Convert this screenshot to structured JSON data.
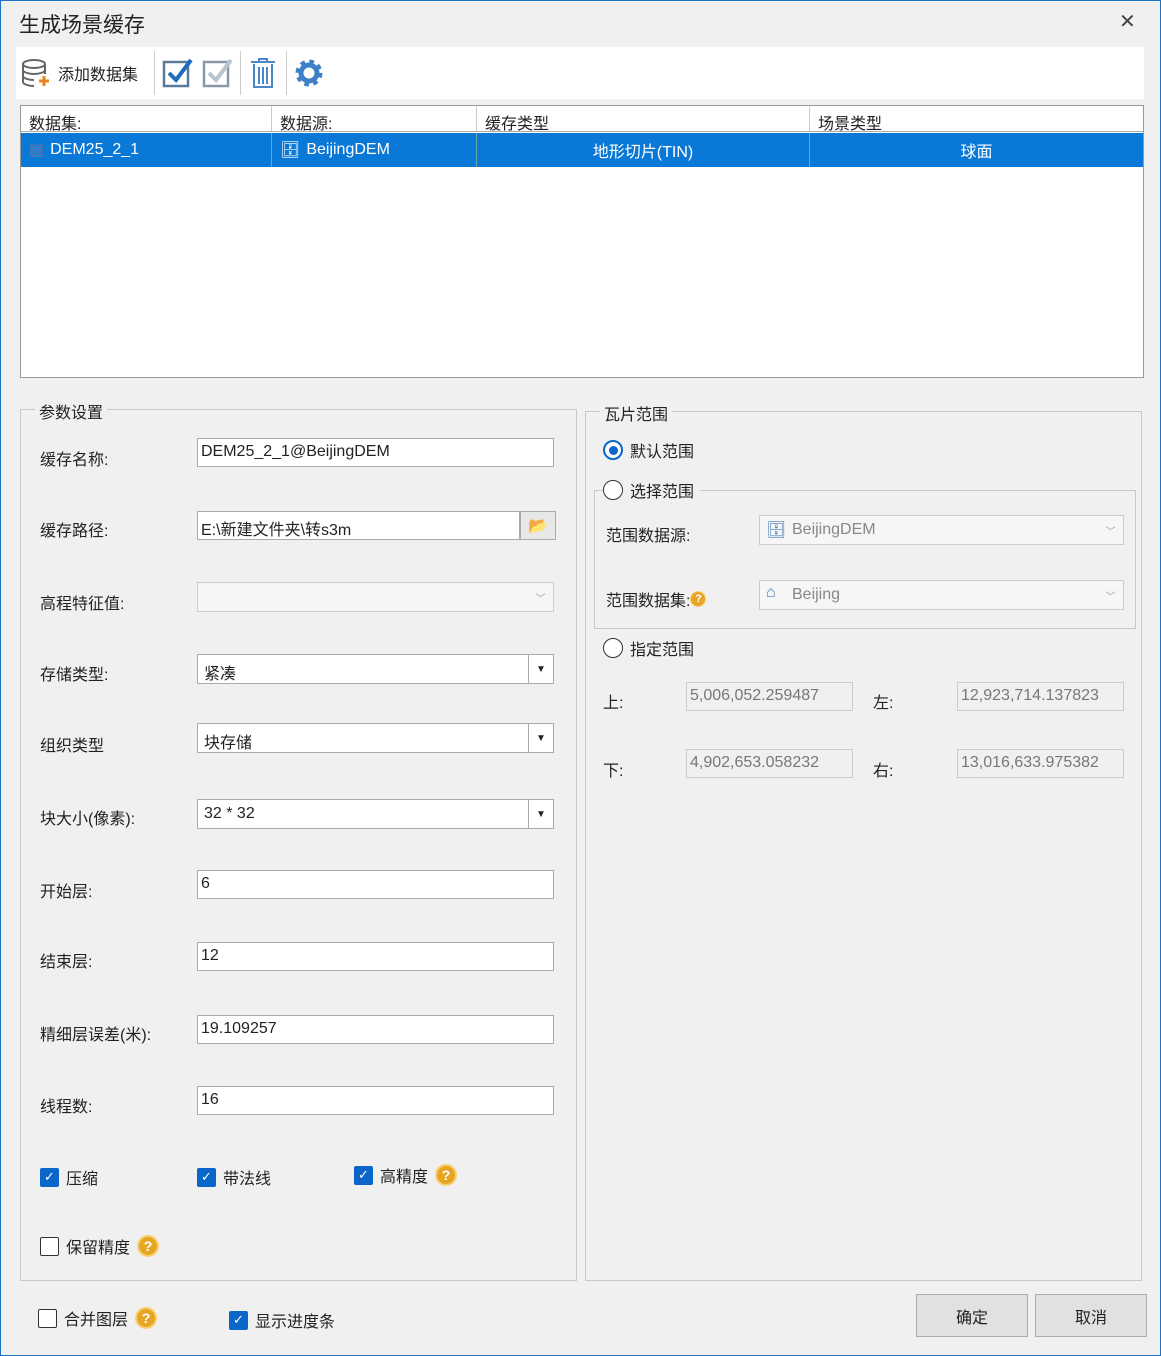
{
  "window": {
    "title": "生成场景缓存",
    "close": "✕"
  },
  "toolbar": {
    "add_dataset": "添加数据集"
  },
  "grid": {
    "headers": [
      "数据集:",
      "数据源:",
      "缓存类型",
      "场景类型"
    ],
    "rows": [
      {
        "dataset": "DEM25_2_1",
        "datasource": "BeijingDEM",
        "cache_type": "地形切片(TIN)",
        "scene_type": "球面"
      }
    ]
  },
  "params": {
    "title": "参数设置",
    "cache_name_label": "缓存名称:",
    "cache_name": "DEM25_2_1@BeijingDEM",
    "cache_path_label": "缓存路径:",
    "cache_path": "E:\\新建文件夹\\转s3m",
    "elevation_label": "高程特征值:",
    "elevation": "",
    "storage_label": "存储类型:",
    "storage": "紧凑",
    "org_label": "组织类型",
    "org": "块存储",
    "block_label": "块大小(像素):",
    "block": "32 * 32",
    "start_label": "开始层:",
    "start": "6",
    "end_label": "结束层:",
    "end": "12",
    "error_label": "精细层误差(米):",
    "error": "19.109257",
    "threads_label": "线程数:",
    "threads": "16",
    "compress": {
      "label": "压缩",
      "checked": true
    },
    "normals": {
      "label": "带法线",
      "checked": true
    },
    "high_precision": {
      "label": "高精度",
      "checked": true
    },
    "keep_precision": {
      "label": "保留精度",
      "checked": false
    }
  },
  "tile": {
    "title": "瓦片范围",
    "default": "默认范围",
    "select": "选择范围",
    "specify": "指定范围",
    "range_ds_label": "范围数据源:",
    "range_ds": "BeijingDEM",
    "range_dt_label": "范围数据集:",
    "range_dt": "Beijing",
    "top_label": "上:",
    "top": "5,006,052.259487",
    "left_label": "左:",
    "left": "12,923,714.137823",
    "bottom_label": "下:",
    "bottom": "4,902,653.058232",
    "right_label": "右:",
    "right": "13,016,633.975382"
  },
  "footer": {
    "merge": {
      "label": "合并图层",
      "checked": false
    },
    "progress": {
      "label": "显示进度条",
      "checked": true
    },
    "ok": "确定",
    "cancel": "取消"
  },
  "help_glyph": "?"
}
